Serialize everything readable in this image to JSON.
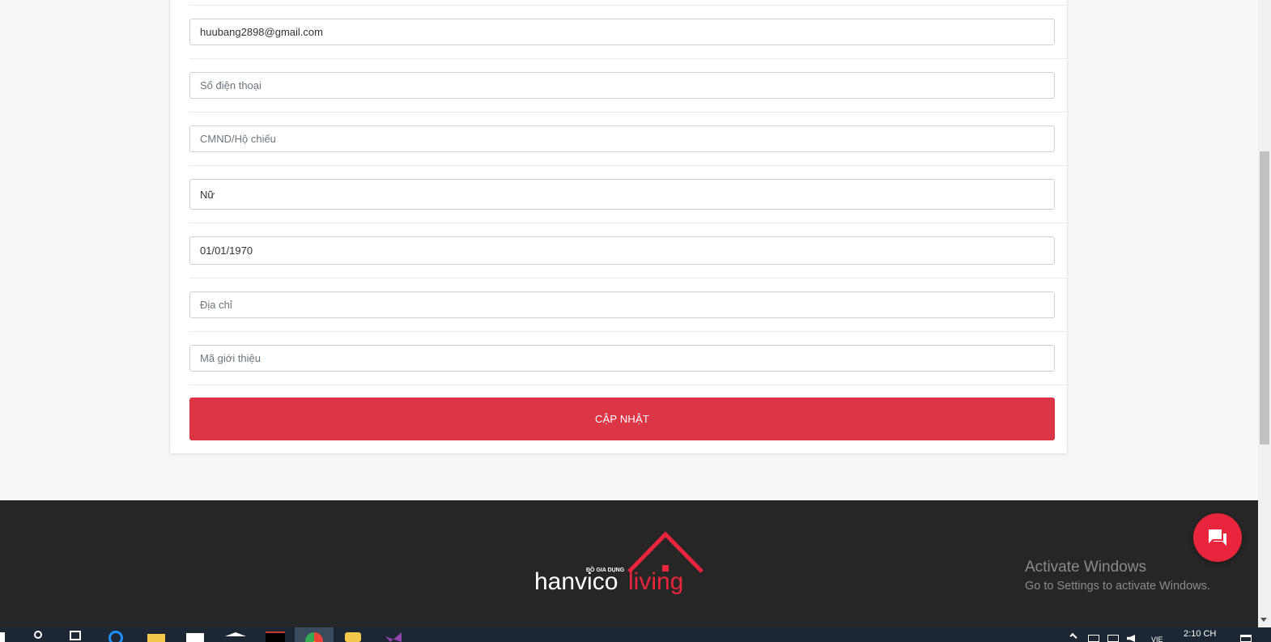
{
  "form": {
    "email_value": "huubang2898@gmail.com",
    "phone_placeholder": "Số điện thoại",
    "id_placeholder": "CMND/Hộ chiếu",
    "gender_value": "Nữ",
    "birthdate_value": "01/01/1970",
    "address_placeholder": "Địa chỉ",
    "referral_placeholder": "Mã giới thiệu",
    "submit_label": "CẬP NHẬT"
  },
  "footer": {
    "logo_tagline": "ĐỒ GIA DỤNG",
    "logo_word1": "hanvico",
    "logo_word2": "living"
  },
  "watermark": {
    "title": "Activate Windows",
    "subtitle": "Go to Settings to activate Windows."
  },
  "taskbar": {
    "language": "VIE",
    "clock": "2:10 CH"
  },
  "colors": {
    "accent": "#dc3545",
    "footer_bg": "#262626",
    "chat_button": "#e8253c"
  }
}
